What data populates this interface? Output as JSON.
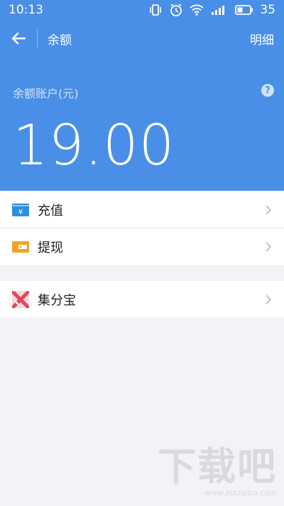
{
  "status_bar": {
    "time": "10:13",
    "battery": "35"
  },
  "toolbar": {
    "title": "余额",
    "detail_link": "明细"
  },
  "balance": {
    "label": "余额账户(元)",
    "amount": "19.00"
  },
  "menu_groups": [
    {
      "items": [
        {
          "label": "充值",
          "icon": "recharge-icon",
          "color": "#2d8ee0"
        },
        {
          "label": "提现",
          "icon": "wallet-icon",
          "color": "#f0a22a"
        }
      ]
    },
    {
      "items": [
        {
          "label": "集分宝",
          "icon": "jifenbao-icon",
          "color": "#e0495a"
        }
      ]
    }
  ],
  "watermark": {
    "big": "下载吧",
    "small": "www.xiazaiba.com"
  },
  "colors": {
    "header_blue": "#4a8fe7",
    "background": "#f2f3f7"
  }
}
